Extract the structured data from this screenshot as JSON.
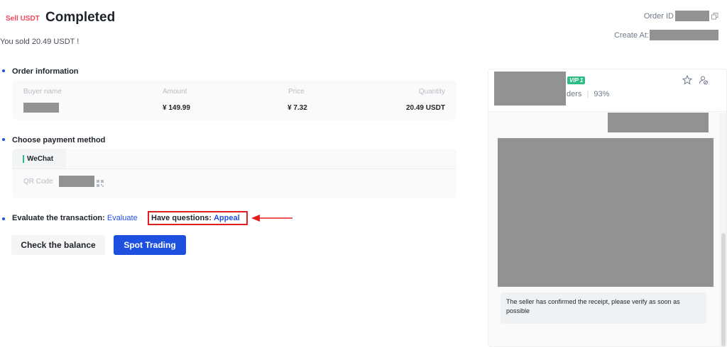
{
  "header": {
    "tag": "Sell USDT",
    "status": "Completed",
    "sold_message": "You sold 20.49 USDT !",
    "order_id_label": "Order ID",
    "create_at_label": "Create At:"
  },
  "order_info": {
    "title": "Order information",
    "columns": [
      "Buyer name",
      "Amount",
      "Price",
      "Quantity"
    ],
    "amount": "¥ 149.99",
    "price": "¥ 7.32",
    "quantity": "20.49 USDT"
  },
  "payment": {
    "title": "Choose payment method",
    "method": "WeChat",
    "qr_label": "QR Code"
  },
  "evaluate": {
    "label": "Evaluate the transaction:",
    "link": "Evaluate",
    "questions_label": "Have questions:",
    "appeal_link": "Appeal"
  },
  "buttons": {
    "check_balance": "Check the balance",
    "spot_trading": "Spot Trading"
  },
  "chat": {
    "vip": "VIP 1",
    "orders_suffix": "ders",
    "completion_rate": "93%",
    "system_message": "The seller has confirmed the receipt, please verify as soon as possible"
  },
  "colors": {
    "accent": "#1e50e0",
    "sell": "#f6465d",
    "highlight_border": "#e02020",
    "wechat": "#2ebd85"
  }
}
